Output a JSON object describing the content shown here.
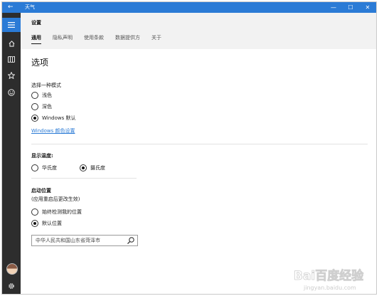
{
  "window": {
    "title": "天气",
    "back": "←",
    "minimize": "—",
    "maximize": "☐",
    "close": "✕"
  },
  "header": {
    "title": "设置",
    "tabs": [
      {
        "label": "通用",
        "active": true
      },
      {
        "label": "隐私声明",
        "active": false
      },
      {
        "label": "使用条款",
        "active": false
      },
      {
        "label": "数据提供方",
        "active": false
      },
      {
        "label": "关于",
        "active": false
      }
    ]
  },
  "options": {
    "section_title": "选项",
    "mode": {
      "label": "选择一种模式",
      "choices": [
        {
          "label": "浅色",
          "checked": false
        },
        {
          "label": "深色",
          "checked": false
        },
        {
          "label": "Windows 默认",
          "checked": true
        }
      ],
      "link": "Windows 颜色设置"
    },
    "temperature": {
      "label": "显示温度:",
      "choices": [
        {
          "label": "华氏度",
          "checked": false
        },
        {
          "label": "摄氏度",
          "checked": true
        }
      ]
    },
    "launch_location": {
      "label": "启动位置",
      "sublabel": "(应用重启后更改生效)",
      "choices": [
        {
          "label": "始终检测我的位置",
          "checked": false
        },
        {
          "label": "默认位置",
          "checked": true
        }
      ],
      "search_value": "中华人民共和国山东省菏泽市"
    }
  },
  "watermark": {
    "text": "Bai百度经验",
    "url_text": "jingyan.baidu.com"
  },
  "colors": {
    "accent": "#2b7bd6",
    "rail": "#2d2d2d",
    "header_bg": "#f2f2f2"
  }
}
